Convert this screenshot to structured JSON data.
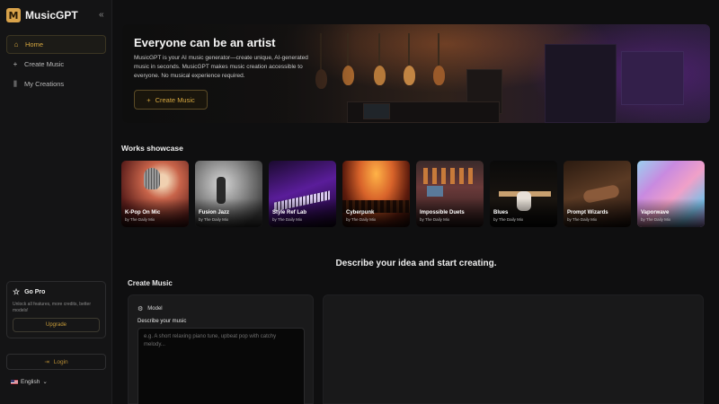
{
  "brand": {
    "logo_letter": "M",
    "name": "MusicGPT"
  },
  "sidebar": {
    "collapse_icon": "chevrons-left-icon",
    "items": [
      {
        "label": "Home",
        "icon": "home-icon",
        "active": true
      },
      {
        "label": "Create Music",
        "icon": "plus-icon",
        "active": false
      },
      {
        "label": "My Creations",
        "icon": "library-icon",
        "active": false
      }
    ],
    "gopro": {
      "title": "Go Pro",
      "text": "Unlock all features, more credits, better models!",
      "button": "Upgrade"
    },
    "login": "Login",
    "language": "English"
  },
  "hero": {
    "title": "Everyone can be an artist",
    "text": "MusicGPT is your AI music generator—create unique, AI-generated music in seconds. MusicGPT makes music creation accessible to everyone. No musical experience required.",
    "button": "Create Music"
  },
  "showcase": {
    "title": "Works showcase",
    "items": [
      {
        "title": "K-Pop On Mic",
        "author": "by The Daily Mix"
      },
      {
        "title": "Fusion Jazz",
        "author": "by The Daily Mix"
      },
      {
        "title": "Style Ref Lab",
        "author": "by The Daily Mix"
      },
      {
        "title": "Cyberpunk",
        "author": "by The Daily Mix"
      },
      {
        "title": "Impossible Duets",
        "author": "by The Daily Mix"
      },
      {
        "title": "Blues",
        "author": "by The Daily Mix"
      },
      {
        "title": "Prompt Wizards",
        "author": "by The Daily Mix"
      },
      {
        "title": "Vaporwave",
        "author": "by The Daily Mix"
      }
    ]
  },
  "create": {
    "headline": "Describe your idea and start creating.",
    "title": "Create Music",
    "model_label": "Model",
    "describe_label": "Describe your music",
    "placeholder": "e.g. A short relaxing piano tune, upbeat pop with catchy melody..."
  },
  "colors": {
    "accent": "#d4a640",
    "background": "#0f0f10",
    "sidebar": "#141415"
  }
}
